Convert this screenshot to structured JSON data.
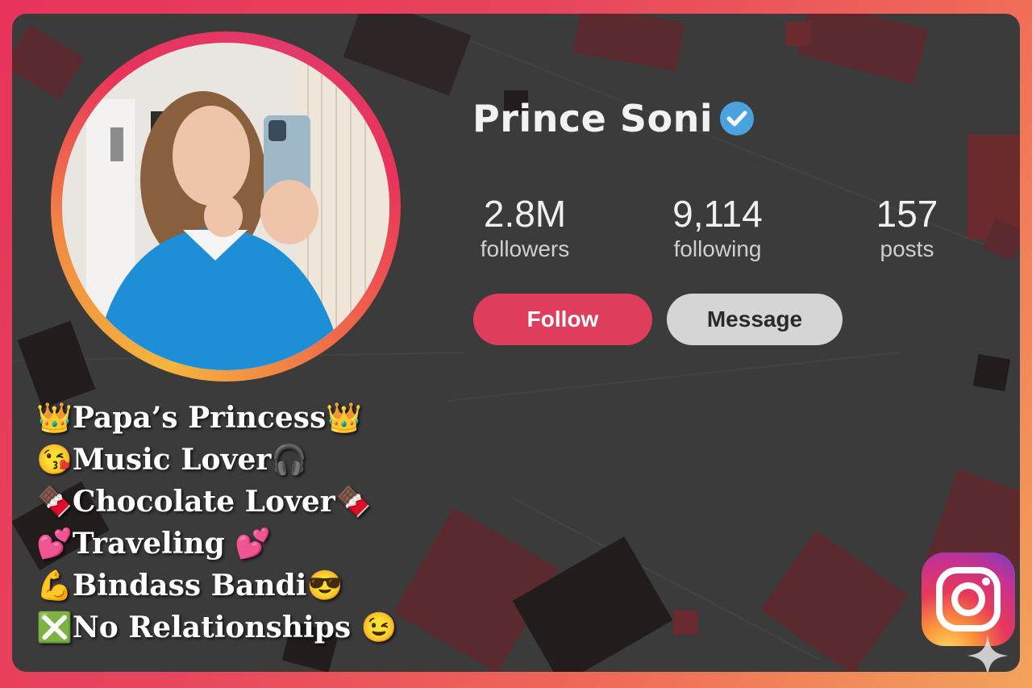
{
  "profile": {
    "name": "Prince Soni",
    "verified_icon": "verified-check-icon"
  },
  "stats": [
    {
      "value": "2.8M",
      "label": "followers"
    },
    {
      "value": "9,114",
      "label": "following"
    },
    {
      "value": "157",
      "label": "posts"
    }
  ],
  "actions": {
    "follow_label": "Follow",
    "message_label": "Message"
  },
  "bio": [
    "👑Papa’s Princess👑",
    "😘Music Lover🎧",
    "🍫Chocolate Lover🍫",
    "💕Traveling 💕",
    "💪Bindass Bandi😎",
    "❎No Relationships 😉"
  ],
  "colors": {
    "frame_gradient_start": "#e8335a",
    "frame_gradient_end": "#f3a35b",
    "card_background": "#3b3b3b",
    "follow_button": "#df3d5c",
    "message_button": "#d5d5d5",
    "verified_badge": "#4aa3df"
  },
  "icons": {
    "instagram_logo": "instagram-logo-icon",
    "sparkle": "sparkle-icon"
  }
}
